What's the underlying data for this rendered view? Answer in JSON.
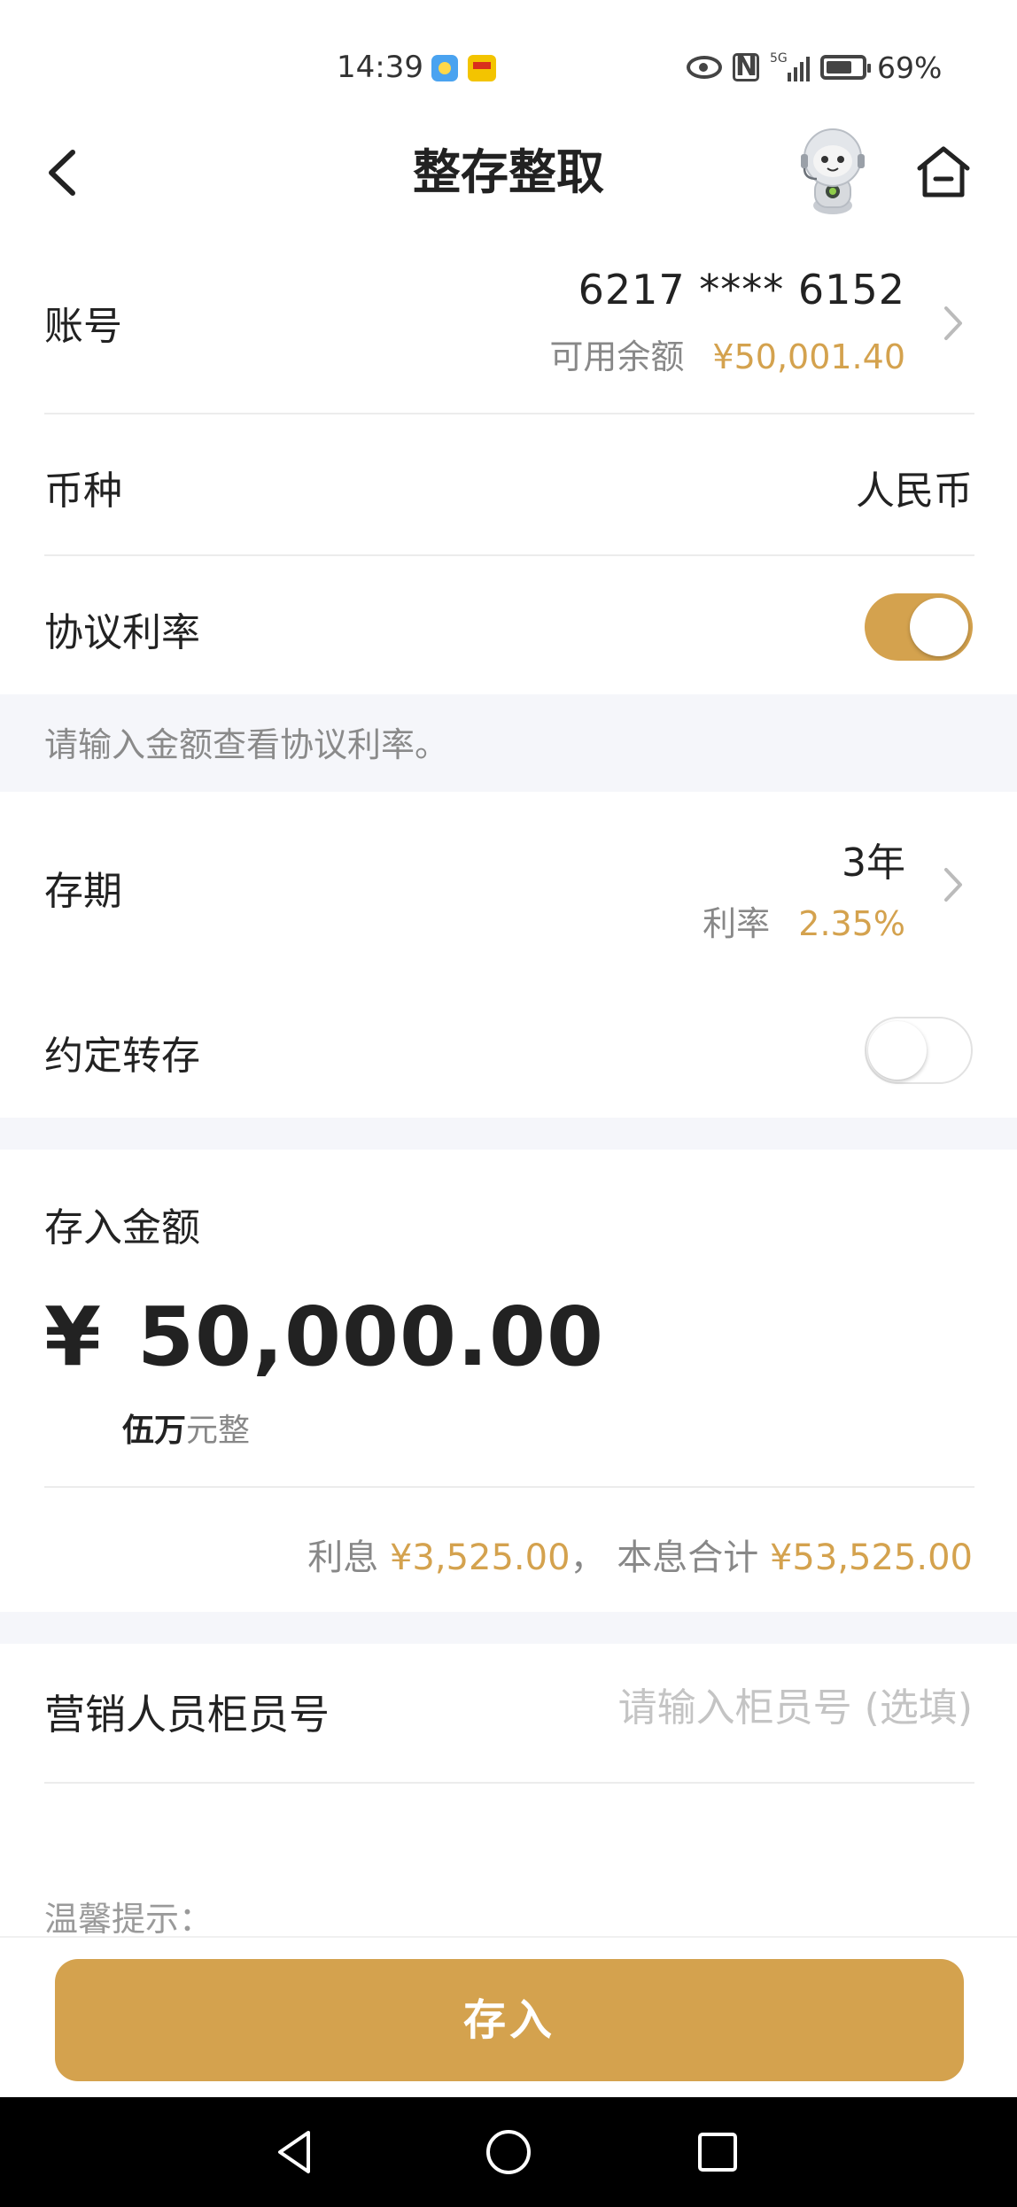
{
  "status_bar": {
    "time": "14:39",
    "network": "5G",
    "battery": "69%"
  },
  "header": {
    "title": "整存整取"
  },
  "account": {
    "label": "账号",
    "number": "6217 **** 6152",
    "balance_label": "可用余额",
    "balance_value": "¥50,001.40"
  },
  "currency": {
    "label": "币种",
    "value": "人民币"
  },
  "negotiated_rate": {
    "label": "协议利率",
    "enabled": true,
    "hint": "请输入金额查看协议利率。"
  },
  "term": {
    "label": "存期",
    "value": "3年",
    "rate_label": "利率",
    "rate_value": "2.35%"
  },
  "auto_renew": {
    "label": "约定转存",
    "enabled": false
  },
  "deposit": {
    "label": "存入金额",
    "currency_symbol": "¥",
    "amount": "50,000.00",
    "words_main": "伍万",
    "words_suffix": "元整",
    "interest_label": "利息",
    "interest_value": "¥3,525.00",
    "separator": "，",
    "total_label": "本息合计",
    "total_value": "¥53,525.00"
  },
  "teller": {
    "label": "营销人员柜员号",
    "placeholder": "请输入柜员号 (选填)"
  },
  "tips": {
    "label": "温馨提示："
  },
  "action": {
    "submit_label": "存入"
  },
  "colors": {
    "accent": "#d4a24e",
    "band": "#f5f6fa",
    "text": "#222222",
    "muted": "#888888"
  }
}
